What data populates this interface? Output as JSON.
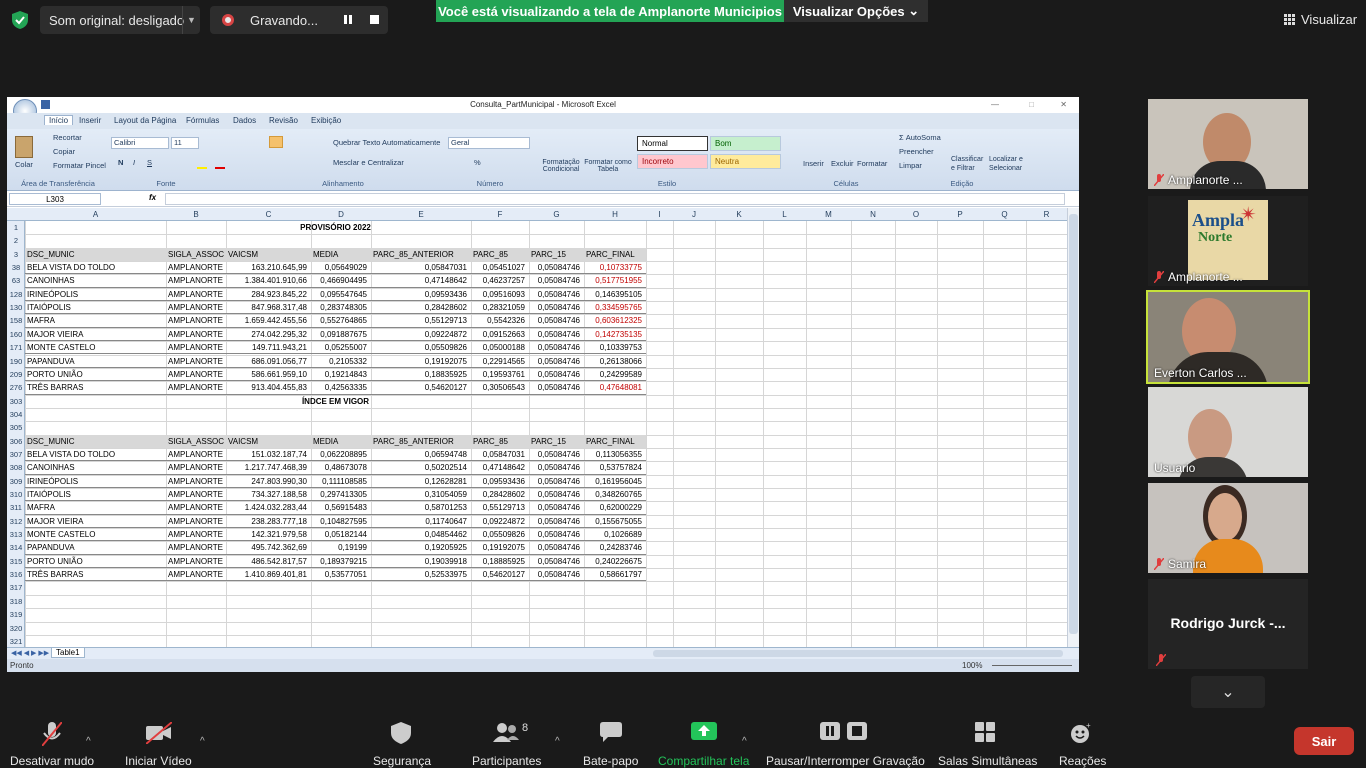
{
  "top": {
    "sound_label": "Som original: desligado",
    "recording_label": "Gravando...",
    "banner": "Você está visualizando a tela de Amplanorte Municipios",
    "view_options": "Visualizar Opções",
    "view_button": "Visualizar"
  },
  "excel": {
    "title": "Consulta_PartMunicipal - Microsoft Excel",
    "tabs": [
      "Início",
      "Inserir",
      "Layout da Página",
      "Fórmulas",
      "Dados",
      "Revisão",
      "Exibição"
    ],
    "clipboard": {
      "cut": "Recortar",
      "copy": "Copiar",
      "paste": "Colar",
      "format_painter": "Formatar Pincel",
      "group": "Área de Transferência"
    },
    "font": {
      "name": "Calibri",
      "size": "11",
      "group": "Fonte"
    },
    "alignment": {
      "wrap": "Quebrar Texto Automaticamente",
      "merge": "Mesclar e Centralizar",
      "group": "Alinhamento"
    },
    "number": {
      "format": "Geral",
      "group": "Número"
    },
    "styles": {
      "cond": "Formatação Condicional",
      "table": "Formatar como Tabela",
      "normal": "Normal",
      "good": "Bom",
      "bad": "Incorreto",
      "neutral": "Neutra",
      "group": "Estilo"
    },
    "cells": {
      "insert": "Inserir",
      "delete": "Excluir",
      "format": "Formatar",
      "group": "Células"
    },
    "editing": {
      "autosum": "AutoSoma",
      "fill": "Preencher",
      "clear": "Limpar",
      "sort": "Classificar e Filtrar",
      "find": "Localizar e Selecionar",
      "group": "Edição"
    },
    "name_box": "L303",
    "columns": [
      "A",
      "B",
      "C",
      "D",
      "E",
      "F",
      "G",
      "H",
      "I",
      "J",
      "K",
      "L",
      "M",
      "N",
      "O",
      "P",
      "Q",
      "R"
    ],
    "sheet_tab": "Table1",
    "status": "Pronto",
    "zoom": "100%",
    "title1": "PROVISÓRIO 2022",
    "title2": "ÍNDCE EM VIGOR",
    "headers": [
      "DSC_MUNIC",
      "SIGLA_ASSOC",
      "VAICSM",
      "MEDIA",
      "PARC_85_ANTERIOR",
      "PARC_85",
      "PARC_15",
      "PARC_FINAL"
    ],
    "table1_rows": [
      "38",
      "63",
      "128",
      "130",
      "158",
      "160",
      "171",
      "190",
      "209",
      "276"
    ],
    "table1": [
      [
        "BELA VISTA DO TOLDO",
        "AMPLANORTE",
        "163.210.645,99",
        "0,05649029",
        "0,05847031",
        "0,05451027",
        "0,05084746",
        "0,10733775"
      ],
      [
        "CANOINHAS",
        "AMPLANORTE",
        "1.384.401.910,66",
        "0,466904495",
        "0,47148642",
        "0,46237257",
        "0,05084746",
        "0,517751955"
      ],
      [
        "IRINEÓPOLIS",
        "AMPLANORTE",
        "284.923.845,22",
        "0,095547645",
        "0,09593436",
        "0,09516093",
        "0,05084746",
        "0,146395105"
      ],
      [
        "ITAIÓPOLIS",
        "AMPLANORTE",
        "847.968.317,48",
        "0,283748305",
        "0,28428602",
        "0,28321059",
        "0,05084746",
        "0,334595765"
      ],
      [
        "MAFRA",
        "AMPLANORTE",
        "1.659.442.455,56",
        "0,552764865",
        "0,55129713",
        "0,5542326",
        "0,05084746",
        "0,603612325"
      ],
      [
        "MAJOR VIEIRA",
        "AMPLANORTE",
        "274.042.295,32",
        "0,091887675",
        "0,09224872",
        "0,09152663",
        "0,05084746",
        "0,142735135"
      ],
      [
        "MONTE CASTELO",
        "AMPLANORTE",
        "149.711.943,21",
        "0,05255007",
        "0,05509826",
        "0,05000188",
        "0,05084746",
        "0,10339753"
      ],
      [
        "PAPANDUVA",
        "AMPLANORTE",
        "686.091.056,77",
        "0,2105332",
        "0,19192075",
        "0,22914565",
        "0,05084746",
        "0,26138066"
      ],
      [
        "PORTO UNIÃO",
        "AMPLANORTE",
        "586.661.959,10",
        "0,19214843",
        "0,18835925",
        "0,19593761",
        "0,05084746",
        "0,24299589"
      ],
      [
        "TRÊS BARRAS",
        "AMPLANORTE",
        "913.404.455,83",
        "0,42563335",
        "0,54620127",
        "0,30506543",
        "0,05084746",
        "0,47648081"
      ]
    ],
    "table1_red": [
      true,
      true,
      false,
      true,
      true,
      true,
      false,
      false,
      false,
      true
    ],
    "table2_rows": [
      "307",
      "308",
      "309",
      "310",
      "311",
      "312",
      "313",
      "314",
      "315",
      "316"
    ],
    "table2": [
      [
        "BELA VISTA DO TOLDO",
        "AMPLANORTE",
        "151.032.187,74",
        "0,062208895",
        "0,06594748",
        "0,05847031",
        "0,05084746",
        "0,113056355"
      ],
      [
        "CANOINHAS",
        "AMPLANORTE",
        "1.217.747.468,39",
        "0,48673078",
        "0,50202514",
        "0,47148642",
        "0,05084746",
        "0,53757824"
      ],
      [
        "IRINEÓPOLIS",
        "AMPLANORTE",
        "247.803.990,30",
        "0,111108585",
        "0,12628281",
        "0,09593436",
        "0,05084746",
        "0,161956045"
      ],
      [
        "ITAIÓPOLIS",
        "AMPLANORTE",
        "734.327.188,58",
        "0,297413305",
        "0,31054059",
        "0,28428602",
        "0,05084746",
        "0,348260765"
      ],
      [
        "MAFRA",
        "AMPLANORTE",
        "1.424.032.283,44",
        "0,56915483",
        "0,58701253",
        "0,55129713",
        "0,05084746",
        "0,62000229"
      ],
      [
        "MAJOR VIEIRA",
        "AMPLANORTE",
        "238.283.777,18",
        "0,104827595",
        "0,11740647",
        "0,09224872",
        "0,05084746",
        "0,155675055"
      ],
      [
        "MONTE CASTELO",
        "AMPLANORTE",
        "142.321.979,58",
        "0,05182144",
        "0,04854462",
        "0,05509826",
        "0,05084746",
        "0,1026689"
      ],
      [
        "PAPANDUVA",
        "AMPLANORTE",
        "495.742.362,69",
        "0,19199",
        "0,19205925",
        "0,19192075",
        "0,05084746",
        "0,24283746"
      ],
      [
        "PORTO UNIÃO",
        "AMPLANORTE",
        "486.542.817,57",
        "0,189379215",
        "0,19039918",
        "0,18885925",
        "0,05084746",
        "0,240226675"
      ],
      [
        "TRÊS BARRAS",
        "AMPLANORTE",
        "1.410.869.401,81",
        "0,53577051",
        "0,52533975",
        "0,54620127",
        "0,05084746",
        "0,58661797"
      ]
    ]
  },
  "participants": [
    "Amplanorte ...",
    "Amplanorte ...",
    "Everton Carlos ...",
    "Usuario",
    "Samira",
    "Rodrigo Jurck -..."
  ],
  "logo_text": [
    "Ampla",
    "Norte"
  ],
  "toolbar": {
    "mute": "Desativar mudo",
    "video": "Iniciar Vídeo",
    "security": "Segurança",
    "participants": "Participantes",
    "participants_count": "8",
    "chat": "Bate-papo",
    "share": "Compartilhar tela",
    "record": "Pausar/Interromper Gravação",
    "rooms": "Salas Simultâneas",
    "reactions": "Reações",
    "leave": "Sair"
  }
}
